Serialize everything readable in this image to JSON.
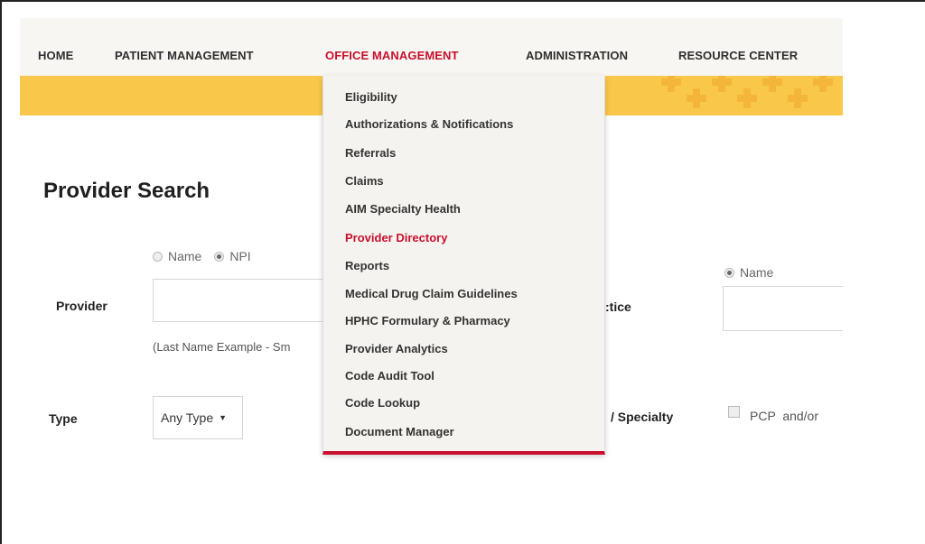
{
  "nav": {
    "items": [
      {
        "label": "HOME"
      },
      {
        "label": "PATIENT MANAGEMENT"
      },
      {
        "label": "OFFICE MANAGEMENT"
      },
      {
        "label": "ADMINISTRATION"
      },
      {
        "label": "RESOURCE CENTER"
      }
    ],
    "active_color": "#c8102e"
  },
  "banner": {
    "color": "#f9c84a"
  },
  "page": {
    "title": "Provider Search"
  },
  "provider": {
    "label": "Provider",
    "radio_name": "Name",
    "radio_npi": "NPI",
    "selected": "NPI",
    "hint": "(Last Name Example - Sm"
  },
  "practice": {
    "label_partial": ":tice",
    "radio_name": "Name"
  },
  "type": {
    "label": "Type",
    "selected": "Any Type"
  },
  "specialty": {
    "label_partial": "/ Specialty",
    "checkbox_label": "PCP  and/or"
  },
  "dropdown": {
    "items": [
      {
        "label": "Eligibility"
      },
      {
        "label": "Authorizations & Notifications"
      },
      {
        "label": "Referrals"
      },
      {
        "label": "Claims"
      },
      {
        "label": "AIM Specialty Health"
      },
      {
        "label": "Provider Directory"
      },
      {
        "label": "Reports"
      },
      {
        "label": "Medical Drug Claim Guidelines"
      },
      {
        "label": "HPHC Formulary & Pharmacy"
      },
      {
        "label": "Provider Analytics"
      },
      {
        "label": "Code Audit Tool"
      },
      {
        "label": "Code Lookup"
      },
      {
        "label": "Document Manager"
      }
    ],
    "active_item": "Provider Directory",
    "accent_color": "#c8102e"
  }
}
